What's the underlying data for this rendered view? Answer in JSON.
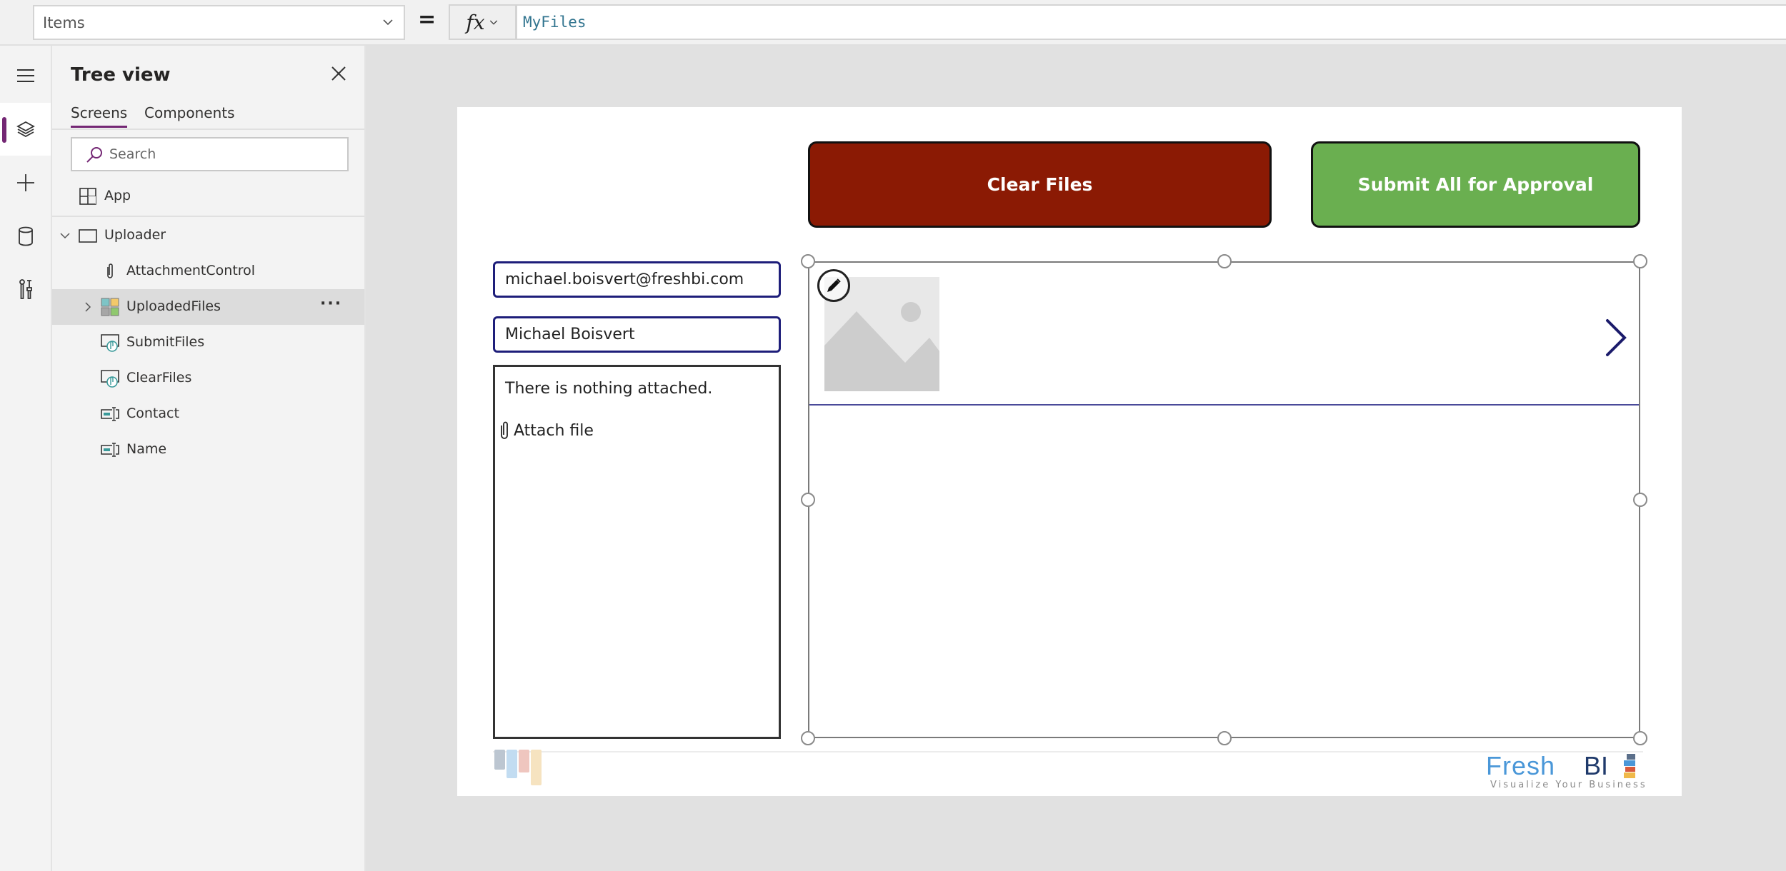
{
  "formula_bar": {
    "property": "Items",
    "equals": "=",
    "fx_label": "fx",
    "formula": "MyFiles"
  },
  "rail": {
    "items": [
      {
        "name": "menu",
        "icon": "hamburger-icon"
      },
      {
        "name": "tree-view",
        "icon": "layers-icon",
        "active": true
      },
      {
        "name": "insert",
        "icon": "plus-icon"
      },
      {
        "name": "data",
        "icon": "database-icon"
      },
      {
        "name": "advanced-tools",
        "icon": "tools-icon"
      }
    ]
  },
  "tree": {
    "title": "Tree view",
    "tabs": [
      {
        "label": "Screens",
        "active": true
      },
      {
        "label": "Components",
        "active": false
      }
    ],
    "search_placeholder": "Search",
    "items": [
      {
        "label": "App",
        "icon": "app-icon",
        "level": 0
      },
      {
        "label": "Uploader",
        "icon": "screen-icon",
        "level": 0,
        "expanded": true
      },
      {
        "label": "AttachmentControl",
        "icon": "paperclip-icon",
        "level": 1
      },
      {
        "label": "UploadedFiles",
        "icon": "gallery-icon",
        "level": 1,
        "selected": true,
        "collapsed": true
      },
      {
        "label": "SubmitFiles",
        "icon": "button-icon",
        "level": 1
      },
      {
        "label": "ClearFiles",
        "icon": "button-icon",
        "level": 1
      },
      {
        "label": "Contact",
        "icon": "text-input-icon",
        "level": 1
      },
      {
        "label": "Name",
        "icon": "text-input-icon",
        "level": 1
      }
    ],
    "more_label": "···"
  },
  "canvas": {
    "clear_button": {
      "label": "Clear Files",
      "color": "#8b1a04"
    },
    "submit_button": {
      "label": "Submit All for Approval",
      "color": "#6aaf50"
    },
    "email_value": "michael.boisvert@freshbi.com",
    "name_value": "Michael Boisvert",
    "attachment": {
      "empty_text": "There is nothing attached.",
      "attach_label": "Attach file"
    },
    "logo": {
      "fresh": "Fresh",
      "bi": "BI",
      "tagline": "Visualize Your Business"
    }
  },
  "colors": {
    "accent": "#742774",
    "input_border": "#1e1e7a"
  }
}
